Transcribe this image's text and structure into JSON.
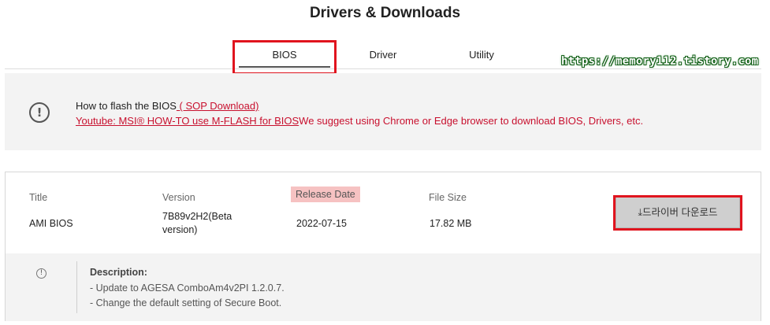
{
  "page": {
    "title": "Drivers & Downloads"
  },
  "tabs": [
    {
      "label": "BIOS",
      "active": true
    },
    {
      "label": "Driver",
      "active": false
    },
    {
      "label": "Utility",
      "active": false
    }
  ],
  "watermark": "https://memory112.tistory.com",
  "notice": {
    "icon": "exclamation-circle-icon",
    "line1_prefix": "How to flash the BIOS",
    "line1_link": " ( SOP Download)",
    "line2_link": "Youtube: MSI® HOW-TO use M-FLASH for BIOS",
    "line2_text": "We suggest using Chrome or Edge browser to download BIOS, Drivers, etc."
  },
  "bios_entry": {
    "labels": {
      "title": "Title",
      "version": "Version",
      "release_date": "Release Date",
      "file_size": "File Size"
    },
    "title": "AMI BIOS",
    "version_line1": "7B89v2H2(Beta",
    "version_line2": "version)",
    "release_date": "2022-07-15",
    "file_size": "17.82 MB",
    "download_label": "⤓드라이버 다운로드",
    "description": {
      "icon": "info-circle-icon",
      "title": "Description:",
      "items": [
        "- Update to AGESA ComboAm4v2PI 1.2.0.7.",
        "- Change the default setting of Secure Boot."
      ]
    }
  },
  "colors": {
    "accent_red": "#e0141e",
    "link_red": "#c8102e",
    "release_highlight": "#f6c2c2"
  }
}
